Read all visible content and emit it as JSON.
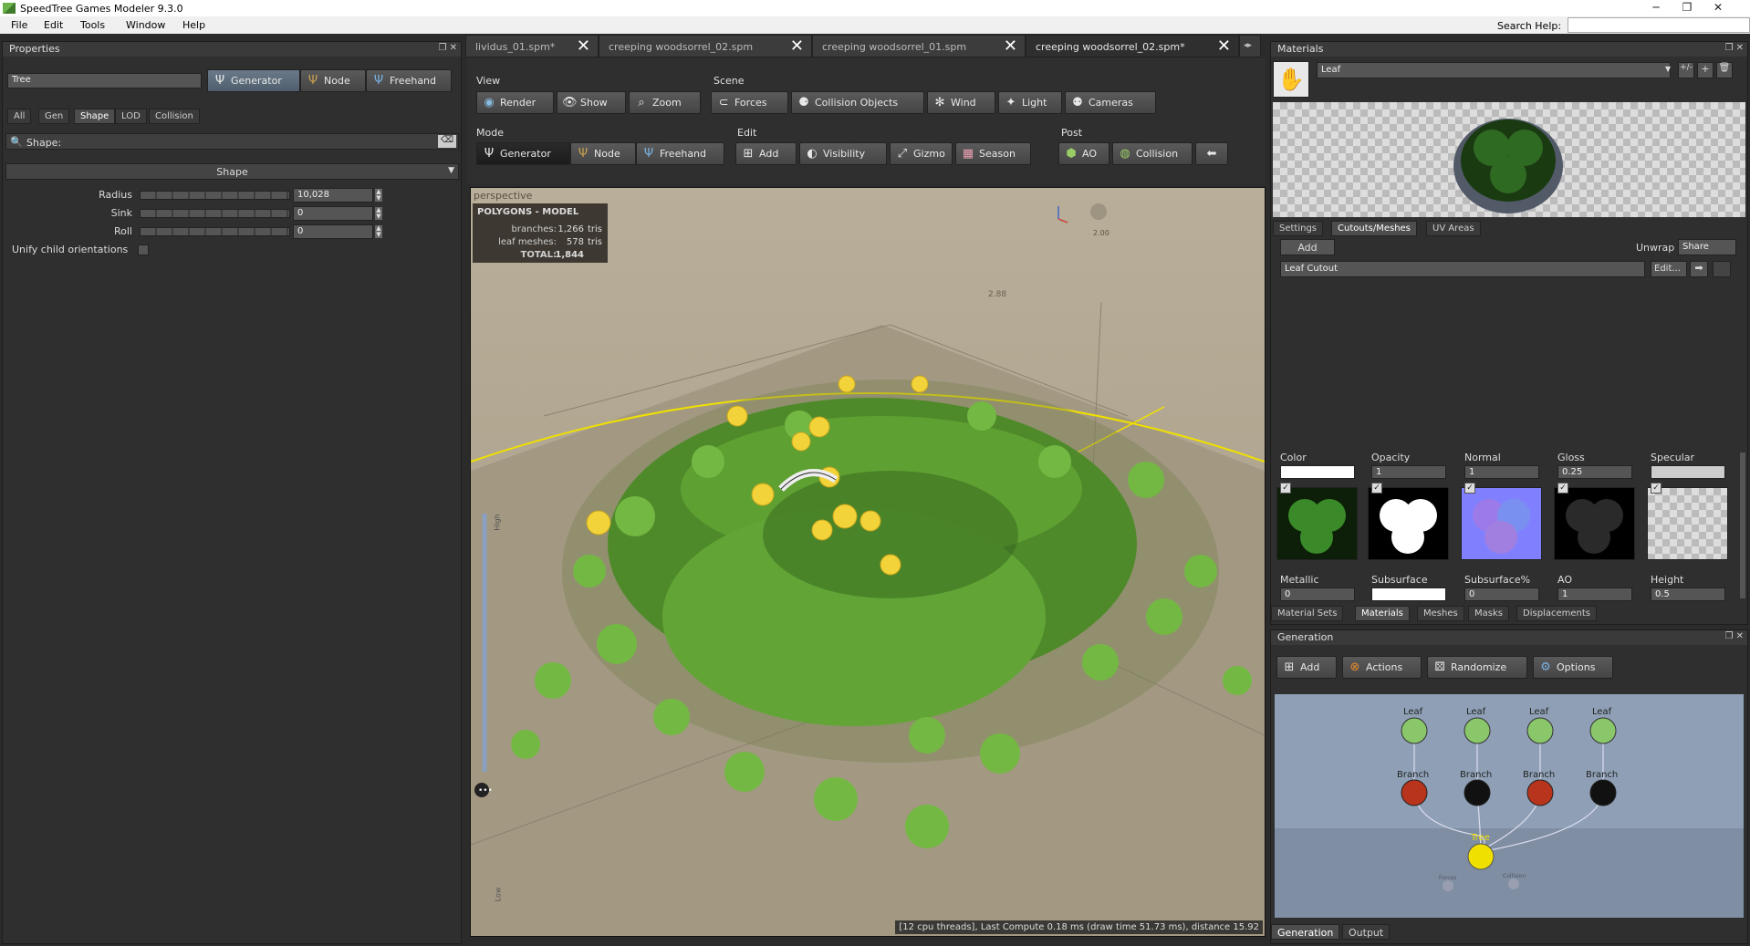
{
  "app": {
    "title": "SpeedTree Games Modeler 9.3.0",
    "menu": [
      "File",
      "Edit",
      "Tools",
      "Window",
      "Help"
    ],
    "search_help_label": "Search Help:"
  },
  "properties": {
    "header": "Properties",
    "object_name": "Tree",
    "mode_buttons": [
      "Generator",
      "Node",
      "Freehand"
    ],
    "filter_tabs": [
      "All",
      "Gen",
      "Shape",
      "LOD",
      "Collision"
    ],
    "search_placeholder": "Shape:",
    "section_title": "Shape",
    "rows": [
      {
        "label": "Radius",
        "value": "10,028"
      },
      {
        "label": "Sink",
        "value": "0"
      },
      {
        "label": "Roll",
        "value": "0"
      }
    ],
    "checkbox_label": "Unify child orientations"
  },
  "doc_tabs": [
    {
      "label": "lividus_01.spm*",
      "selected": false
    },
    {
      "label": "creeping woodsorrel_02.spm",
      "selected": false
    },
    {
      "label": "creeping woodsorrel_01.spm",
      "selected": false
    },
    {
      "label": "creeping woodsorrel_02.spm*",
      "selected": true
    }
  ],
  "toolbar": {
    "view_label": "View",
    "view_buttons": [
      "Render",
      "Show",
      "Zoom"
    ],
    "scene_label": "Scene",
    "scene_buttons": [
      "Forces",
      "Collision Objects",
      "Wind",
      "Light",
      "Cameras"
    ],
    "mode_label": "Mode",
    "mode_buttons": [
      "Generator",
      "Node",
      "Freehand"
    ],
    "edit_label": "Edit",
    "edit_buttons": [
      "Add",
      "Visibility",
      "Gizmo",
      "Season"
    ],
    "post_label": "Post",
    "post_buttons": [
      "AO",
      "Collision"
    ]
  },
  "viewport": {
    "camera_label": "perspective",
    "stats_title": "POLYGONS - MODEL",
    "stats": [
      {
        "label": "branches:",
        "value": "1,266",
        "unit": "tris"
      },
      {
        "label": "leaf meshes:",
        "value": "578",
        "unit": "tris"
      },
      {
        "label": "TOTAL:",
        "value": "1,844",
        "unit": ""
      }
    ],
    "scale_label": "2.88",
    "axis_value": "2.00",
    "lod_high": "High",
    "lod_low": "Low",
    "status": "[12 cpu threads], Last Compute 0.18 ms (draw time 51.73 ms), distance 15.92"
  },
  "materials": {
    "header": "Materials",
    "selected_material": "Leaf",
    "tabs": [
      "Settings",
      "Cutouts/Meshes",
      "UV Areas"
    ],
    "add_label": "Add",
    "unwrap_label": "Unwrap",
    "unwrap_value": "Share",
    "cutout_value": "Leaf Cutout",
    "edit_label": "Edit...",
    "maps": [
      {
        "label": "Color",
        "value": ""
      },
      {
        "label": "Opacity",
        "value": "1"
      },
      {
        "label": "Normal",
        "value": "1"
      },
      {
        "label": "Gloss",
        "value": "0.25"
      },
      {
        "label": "Specular",
        "value": ""
      }
    ],
    "maps2": [
      {
        "label": "Metallic",
        "value": "0"
      },
      {
        "label": "Subsurface",
        "value": ""
      },
      {
        "label": "Subsurface%",
        "value": "0"
      },
      {
        "label": "AO",
        "value": "1"
      },
      {
        "label": "Height",
        "value": "0.5"
      }
    ],
    "bottom_tabs": [
      "Material Sets",
      "Materials",
      "Meshes",
      "Masks",
      "Displacements"
    ]
  },
  "generation": {
    "header": "Generation",
    "buttons": [
      "Add",
      "Actions",
      "Randomize",
      "Options"
    ],
    "nodes": {
      "leaf": "Leaf",
      "branch": "Branch",
      "tree": "Tree",
      "forces": "Forces",
      "collision": "Collision"
    },
    "bottom_tabs": [
      "Generation",
      "Output"
    ]
  },
  "colors": {
    "panel_bg": "#2f2f2f",
    "accent": "#6a7a8a",
    "selection_yellow": "#f0e000"
  }
}
